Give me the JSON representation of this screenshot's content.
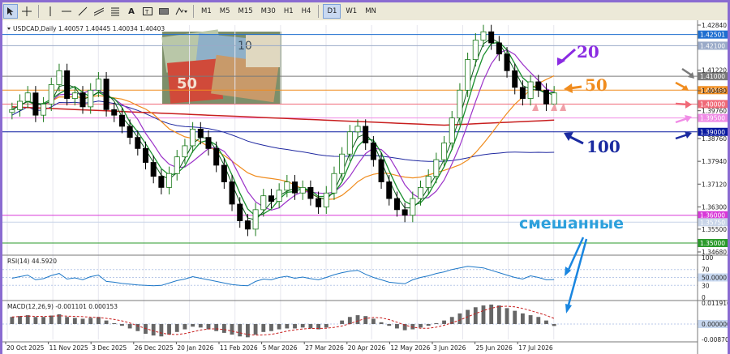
{
  "toolbar": {
    "timeframes": [
      "M1",
      "M5",
      "M15",
      "M30",
      "H1",
      "H4",
      "D1",
      "W1",
      "MN"
    ],
    "active_timeframe": "D1"
  },
  "header": {
    "symbol_label": "USDCAD,Daily  1.40057 1.40445 1.40034 1.40403"
  },
  "annotations": {
    "ma20": "20",
    "ma50": "50",
    "ma100": "100",
    "mixed": "смешанные"
  },
  "colors": {
    "ma20": "#9b32c8",
    "ma50": "#f08c1e",
    "ma100": "#1f28a0",
    "ma200": "#c81e1e",
    "ema_fast": "#1a8f2e",
    "ema_slow": "#0a5a1a",
    "bull": "#1a7a1a",
    "bear": "#000000",
    "arrow_blue": "#1a86e0",
    "mixed_text": "#2da0dc"
  },
  "chart_data": {
    "type": "candlestick",
    "symbol": "USDCAD",
    "timeframe": "Daily",
    "last_ohlc": {
      "open": 1.40057,
      "high": 1.40445,
      "low": 1.40034,
      "close": 1.40403
    },
    "price_ticks": [
      "1.42840",
      "1.41220",
      "1.40480",
      "1.39760",
      "1.38760",
      "1.37940",
      "1.37120",
      "1.36300",
      "1.35500",
      "1.34680"
    ],
    "price_range": [
      1.3468,
      1.4284
    ],
    "levels": [
      {
        "value": 1.425,
        "label": "1.42501",
        "color": "#1f6fd0"
      },
      {
        "value": 1.421,
        "label": "1.42100",
        "color": "#9aaac8"
      },
      {
        "value": 1.41,
        "label": "1.41000",
        "color": "#7a7a7a"
      },
      {
        "value": 1.405,
        "label": "1.40500",
        "color": "#f08c1e"
      },
      {
        "value": 1.4,
        "label": "1.40000",
        "color": "#f06a78"
      },
      {
        "value": 1.395,
        "label": "1.39500",
        "color": "#f08ce6"
      },
      {
        "value": 1.39,
        "label": "1.39000",
        "color": "#0a1aa0"
      },
      {
        "value": 1.36,
        "label": "1.36000",
        "color": "#d838d8"
      },
      {
        "value": 1.3575,
        "label": "1.35750",
        "color": "#c8d4e8"
      },
      {
        "value": 1.35,
        "label": "1.35000",
        "color": "#2a9a2a"
      }
    ],
    "x_dates": [
      "20 Oct 2025",
      "11 Nov 2025",
      "3 Dec 2025",
      "26 Dec 2025",
      "20 Jan 2026",
      "11 Feb 2026",
      "5 Mar 2026",
      "27 Mar 2026",
      "20 Apr 2026",
      "12 May 2026",
      "3 Jun 2026",
      "25 Jun 2026",
      "17 Jul 2026"
    ],
    "closes": [
      1.398,
      1.401,
      1.404,
      1.396,
      1.4,
      1.407,
      1.412,
      1.402,
      1.404,
      1.399,
      1.405,
      1.409,
      1.398,
      1.396,
      1.392,
      1.388,
      1.384,
      1.379,
      1.374,
      1.37,
      1.375,
      1.381,
      1.385,
      1.391,
      1.388,
      1.384,
      1.378,
      1.372,
      1.364,
      1.358,
      1.355,
      1.362,
      1.367,
      1.365,
      1.369,
      1.372,
      1.368,
      1.37,
      1.366,
      1.363,
      1.368,
      1.375,
      1.382,
      1.39,
      1.392,
      1.386,
      1.38,
      1.372,
      1.366,
      1.362,
      1.36,
      1.366,
      1.37,
      1.374,
      1.38,
      1.386,
      1.395,
      1.405,
      1.416,
      1.423,
      1.426,
      1.422,
      1.418,
      1.412,
      1.406,
      1.402,
      1.408,
      1.405,
      1.4,
      1.404
    ],
    "rsi": {
      "label": "RSI(14) 44.5920",
      "value": 44.592,
      "ticks": [
        "100",
        "70",
        "50.0000",
        "30",
        "0"
      ],
      "levels": [
        70,
        50,
        30
      ],
      "values": [
        48,
        52,
        56,
        44,
        47,
        55,
        60,
        46,
        49,
        44,
        52,
        56,
        40,
        38,
        35,
        33,
        31,
        30,
        29,
        30,
        36,
        42,
        46,
        52,
        48,
        44,
        40,
        36,
        32,
        30,
        29,
        40,
        46,
        44,
        50,
        53,
        48,
        51,
        47,
        44,
        50,
        57,
        62,
        66,
        68,
        58,
        50,
        44,
        38,
        36,
        34,
        44,
        50,
        54,
        60,
        64,
        70,
        74,
        78,
        76,
        74,
        68,
        62,
        56,
        50,
        46,
        54,
        50,
        44,
        44.6
      ]
    },
    "macd": {
      "label": "MACD(12,26,9) -0.001101 0.000153",
      "macd_value": -0.001101,
      "signal_value": 0.000153,
      "ticks": [
        "0.011916",
        "0.000000",
        "-0.008709"
      ],
      "range": [
        -0.008709,
        0.011916
      ],
      "histogram": [
        0.004,
        0.0045,
        0.005,
        0.004,
        0.004,
        0.0048,
        0.0055,
        0.004,
        0.0035,
        0.003,
        0.0035,
        0.004,
        0.002,
        0.0005,
        -0.001,
        -0.0025,
        -0.004,
        -0.0055,
        -0.0065,
        -0.007,
        -0.006,
        -0.0045,
        -0.003,
        -0.0015,
        -0.002,
        -0.003,
        -0.004,
        -0.005,
        -0.006,
        -0.007,
        -0.0075,
        -0.006,
        -0.0045,
        -0.004,
        -0.003,
        -0.0025,
        -0.0025,
        -0.002,
        -0.0025,
        -0.003,
        -0.002,
        0.0,
        0.002,
        0.004,
        0.005,
        0.0045,
        0.003,
        0.001,
        -0.001,
        -0.0025,
        -0.0035,
        -0.003,
        -0.002,
        -0.001,
        0.0005,
        0.002,
        0.004,
        0.006,
        0.008,
        0.0095,
        0.0105,
        0.011,
        0.0105,
        0.009,
        0.0075,
        0.006,
        0.005,
        0.004,
        0.002,
        -0.0011
      ]
    }
  }
}
